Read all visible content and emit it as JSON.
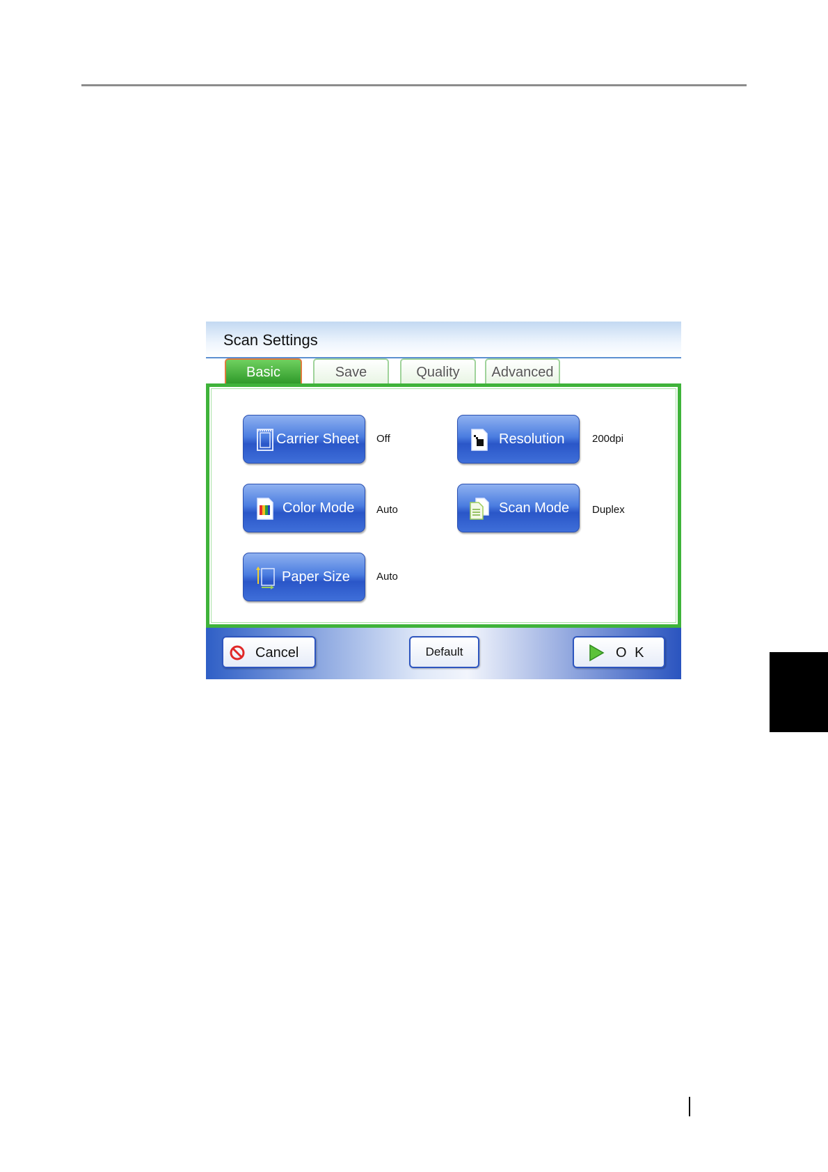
{
  "dialog": {
    "title": "Scan Settings",
    "tabs": [
      {
        "label": "Basic",
        "active": true
      },
      {
        "label": "Save",
        "active": false
      },
      {
        "label": "Quality",
        "active": false
      },
      {
        "label": "Advanced",
        "active": false
      }
    ],
    "settings": [
      {
        "label": "Carrier Sheet",
        "value": "Off",
        "icon": "carrier-sheet-icon"
      },
      {
        "label": "Resolution",
        "value": "200dpi",
        "icon": "resolution-icon"
      },
      {
        "label": "Color Mode",
        "value": "Auto",
        "icon": "color-mode-icon"
      },
      {
        "label": "Scan Mode",
        "value": "Duplex",
        "icon": "scan-mode-icon"
      },
      {
        "label": "Paper Size",
        "value": "Auto",
        "icon": "paper-size-icon"
      }
    ],
    "buttons": {
      "cancel": "Cancel",
      "default": "Default",
      "ok": "O K"
    }
  },
  "colors": {
    "accent_green": "#3fb33a",
    "button_blue": "#2a56c8",
    "active_tab_border": "#e07a3b"
  }
}
